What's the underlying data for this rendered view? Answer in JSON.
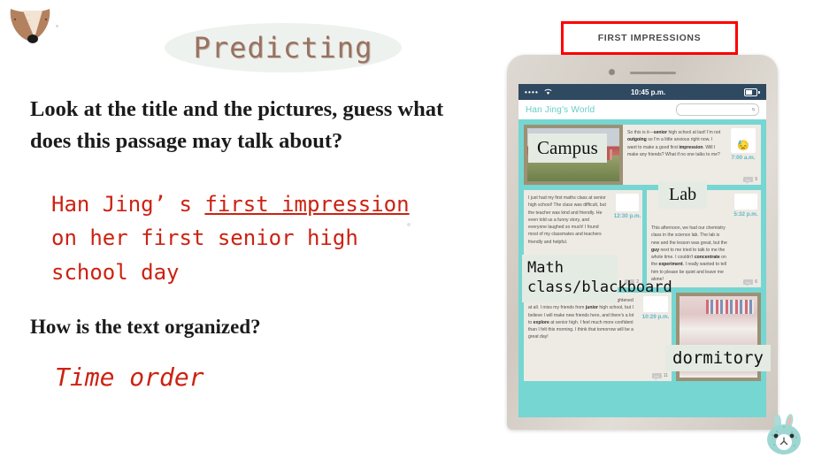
{
  "slide": {
    "title": "Predicting",
    "questions": [
      "Look at the title and the pictures, guess what does this passage may talk about?",
      "How is the text organized?"
    ],
    "answer_one": {
      "prefix": "Han Jing’ s ",
      "underline_a": "first impression",
      "middle": " on her first senior high school day"
    },
    "answer_two": "Time order"
  },
  "banner": {
    "label": "FIRST IMPRESSIONS"
  },
  "tablet": {
    "status": {
      "signal_dots": "••••",
      "wifi": "◠",
      "time": "10:45 p.m."
    },
    "nav": {
      "title": "Han Jing's World",
      "search_icon": "⌕"
    },
    "entries": [
      {
        "text_html": "So this is it—<b>senior</b> high school at last! I'm not <b>outgoing</b> so I'm a little anxious right now. I want to make a good first <b>impression</b>. Will I make any friends? What if no one talks to me?",
        "time": "7:00 a.m.",
        "comments": "9",
        "emoji": "😓"
      },
      {
        "text_html": "I just had my first maths class at senior high school! The class was difficult, but the teacher was kind and friendly. He even told us a funny story, and everyone laughed so much! I found most of my classmates and teachers friendly and helpful.",
        "time": "12:30 p.m.",
        "comments": "2",
        "emoji": ""
      },
      {
        "text_html": "This afternoon, we had our chemistry class in the science lab. The lab is new and the lesson was great, but the <b>guy</b> next to me tried to talk to me the whole time. I couldn't <b>concentrate</b> on the <b>experiment</b>. I really wanted to tell him to please be quiet and leave me alone!",
        "time": "5:32 p.m.",
        "comments": "6",
        "emoji": ""
      },
      {
        "text_html": "…led that …rong. I didn't feel <b>awkward</b> or frightened at all. I miss my friends from <b>junior</b> high school, but I believe I will make new friends here, and there's a lot to <b>explore</b> at senior high. I feel much more confident than I felt this morning. I think that tomorrow will be a great day!",
        "time": "10:29 p.m.",
        "comments": "11",
        "emoji": ""
      }
    ]
  },
  "annotations": {
    "campus": "Campus",
    "lab": "Lab",
    "math": "Math class/blackboard",
    "dormitory": "dormitory"
  },
  "colors": {
    "accent_red": "#cc2211",
    "banner_red": "#ff0000",
    "title_brown": "#9a7160",
    "screen_teal": "#76d6d2",
    "nav_blue": "#67ccc6",
    "label_bg": "#e4ebe3"
  }
}
